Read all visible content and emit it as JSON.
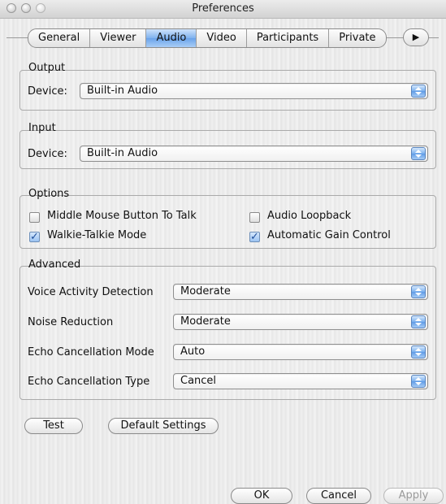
{
  "window": {
    "title": "Preferences"
  },
  "tabs": [
    {
      "label": "General"
    },
    {
      "label": "Viewer"
    },
    {
      "label": "Audio"
    },
    {
      "label": "Video"
    },
    {
      "label": "Participants"
    },
    {
      "label": "Private"
    }
  ],
  "active_tab": "Audio",
  "output": {
    "group_label": "Output",
    "device_label": "Device:",
    "device_value": "Built-in Audio"
  },
  "input": {
    "group_label": "Input",
    "device_label": "Device:",
    "device_value": "Built-in Audio"
  },
  "options": {
    "group_label": "Options",
    "items": [
      {
        "label": "Middle Mouse Button To Talk",
        "checked": false
      },
      {
        "label": "Audio Loopback",
        "checked": false
      },
      {
        "label": "Walkie-Talkie Mode",
        "checked": true
      },
      {
        "label": "Automatic Gain Control",
        "checked": true
      }
    ]
  },
  "advanced": {
    "group_label": "Advanced",
    "rows": [
      {
        "label": "Voice Activity Detection",
        "value": "Moderate"
      },
      {
        "label": "Noise Reduction",
        "value": "Moderate"
      },
      {
        "label": "Echo Cancellation Mode",
        "value": "Auto"
      },
      {
        "label": "Echo Cancellation Type",
        "value": "Cancel"
      }
    ]
  },
  "actions": {
    "test": "Test",
    "default_settings": "Default Settings"
  },
  "footer": {
    "ok": "OK",
    "cancel": "Cancel",
    "apply": "Apply"
  },
  "colors": {
    "accent": "#6aa3ea",
    "check": "#1f4f9a"
  }
}
